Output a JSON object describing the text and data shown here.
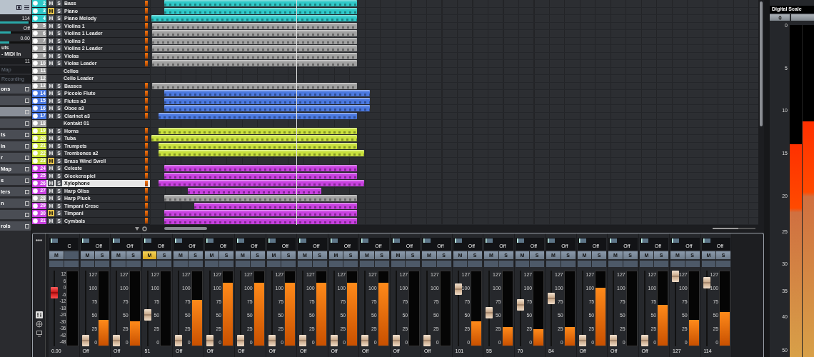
{
  "inspector": {
    "sliders": [
      {
        "value": "114",
        "level": 0.95
      },
      {
        "value": "Off",
        "level": 0.35
      },
      {
        "value": "0.00",
        "level": 0.3
      }
    ],
    "routing": [
      "uts",
      "- MIDI In",
      "11"
    ],
    "options": [
      {
        "label": "Map",
        "disabled": true
      },
      {
        "label": "Recording",
        "disabled": true
      }
    ],
    "sections": [
      {
        "label": "ons",
        "selected": false
      },
      {
        "selected": false
      },
      {
        "selected": true
      },
      {
        "selected": false
      },
      {
        "label": "ts",
        "selected": false
      },
      {
        "label": "in",
        "selected": false
      },
      {
        "label": "r",
        "selected": false
      },
      {
        "label": "Map",
        "selected": false
      },
      {
        "label": "s",
        "selected": false
      },
      {
        "label": "lers",
        "selected": false
      },
      {
        "label": "n",
        "selected": false
      },
      {
        "selected": false
      },
      {
        "label": "rols",
        "selected": false
      }
    ]
  },
  "tracks": [
    {
      "number": "2",
      "name": "Bass",
      "color": "#2ec8c8",
      "kind": "track",
      "m": "M",
      "s": "S",
      "muted": false,
      "selected": false
    },
    {
      "number": "3",
      "name": "Piano",
      "color": "#2ec8c8",
      "kind": "track",
      "m": "M",
      "s": "S",
      "muted": true,
      "selected": false
    },
    {
      "number": "4",
      "name": "Piano Melody",
      "color": "#2ec8c8",
      "kind": "track",
      "m": "M",
      "s": "S",
      "muted": false,
      "selected": false
    },
    {
      "number": "5",
      "name": "Violins 1",
      "color": "#a0a0a0",
      "kind": "track",
      "m": "M",
      "s": "S",
      "muted": false,
      "selected": false
    },
    {
      "number": "6",
      "name": "Violins 1 Leader",
      "color": "#a0a0a0",
      "kind": "track",
      "m": "M",
      "s": "S",
      "muted": false,
      "selected": false
    },
    {
      "number": "7",
      "name": "Violins 2",
      "color": "#a0a0a0",
      "kind": "track",
      "m": "M",
      "s": "S",
      "muted": false,
      "selected": false
    },
    {
      "number": "8",
      "name": "Violins 2 Leader",
      "color": "#a0a0a0",
      "kind": "track",
      "m": "M",
      "s": "S",
      "muted": false,
      "selected": false
    },
    {
      "number": "9",
      "name": "Violas",
      "color": "#a0a0a0",
      "kind": "track",
      "m": "M",
      "s": "S",
      "muted": false,
      "selected": false
    },
    {
      "number": "10",
      "name": "Violas Leader",
      "color": "#a0a0a0",
      "kind": "track",
      "m": "M",
      "s": "S",
      "muted": false,
      "selected": false
    },
    {
      "number": "11",
      "name": "Cellos",
      "color": "#a0a0a0",
      "kind": "bare",
      "selected": false
    },
    {
      "number": "12",
      "name": "Cello Leader",
      "color": "#a0a0a0",
      "kind": "bare",
      "selected": false
    },
    {
      "number": "13",
      "name": "Basses",
      "color": "#a0a0a0",
      "kind": "track",
      "m": "M",
      "s": "S",
      "muted": false,
      "selected": false
    },
    {
      "number": "14",
      "name": "Piccolo Flute",
      "color": "#4a78e0",
      "kind": "track",
      "m": "M",
      "s": "S",
      "muted": false,
      "selected": false
    },
    {
      "number": "15",
      "name": "Flutes a3",
      "color": "#4a78e0",
      "kind": "track",
      "m": "M",
      "s": "S",
      "muted": false,
      "selected": false
    },
    {
      "number": "16",
      "name": "Oboe a3",
      "color": "#4a78e0",
      "kind": "track",
      "m": "M",
      "s": "S",
      "muted": false,
      "selected": false
    },
    {
      "number": "17",
      "name": "Clarinet a3",
      "color": "#4a78e0",
      "kind": "track",
      "m": "M",
      "s": "S",
      "muted": false,
      "selected": false
    },
    {
      "number": "18",
      "name": "Kontakt 01",
      "color": "#a0a0a0",
      "kind": "bare",
      "selected": false
    },
    {
      "number": "19",
      "name": "Horns",
      "color": "#c8e03c",
      "kind": "track",
      "m": "M",
      "s": "S",
      "muted": false,
      "selected": false
    },
    {
      "number": "20",
      "name": "Tuba",
      "color": "#c8e03c",
      "kind": "track",
      "m": "M",
      "s": "S",
      "muted": false,
      "selected": false
    },
    {
      "number": "21",
      "name": "Trumpets",
      "color": "#c8e03c",
      "kind": "track",
      "m": "M",
      "s": "S",
      "muted": false,
      "selected": false
    },
    {
      "number": "22",
      "name": "Trombones a2",
      "color": "#c8e03c",
      "kind": "track",
      "m": "M",
      "s": "S",
      "muted": false,
      "selected": false
    },
    {
      "number": "23",
      "name": "Brass Wind Swell",
      "color": "#c8e03c",
      "kind": "track",
      "m": "M",
      "s": "S",
      "muted": true,
      "selected": false
    },
    {
      "number": "24",
      "name": "Celeste",
      "color": "#c840e0",
      "kind": "track",
      "m": "M",
      "s": "S",
      "muted": false,
      "selected": false
    },
    {
      "number": "25",
      "name": "Glockenspiel",
      "color": "#c840e0",
      "kind": "track",
      "m": "M",
      "s": "S",
      "muted": false,
      "selected": false
    },
    {
      "number": "26",
      "name": "Xylophone",
      "color": "#c840e0",
      "kind": "track",
      "m": "M",
      "s": "S",
      "muted": false,
      "selected": true
    },
    {
      "number": "27",
      "name": "Harp Gliss",
      "color": "#c840e0",
      "kind": "track",
      "m": "M",
      "s": "S",
      "muted": false,
      "selected": false
    },
    {
      "number": "28",
      "name": "Harp Pluck",
      "color": "#a0a0a0",
      "kind": "track",
      "m": "M",
      "s": "S",
      "muted": false,
      "selected": false
    },
    {
      "number": "29",
      "name": "Timpani Cresc",
      "color": "#c840e0",
      "kind": "track",
      "m": "M",
      "s": "S",
      "muted": false,
      "selected": false
    },
    {
      "number": "30",
      "name": "Timpani",
      "color": "#c840e0",
      "kind": "track",
      "m": "M",
      "s": "S",
      "muted": true,
      "selected": false
    },
    {
      "number": "31",
      "name": "Cymbals",
      "color": "#c840e0",
      "kind": "track",
      "m": "M",
      "s": "S",
      "muted": false,
      "selected": false
    }
  ],
  "mixer": {
    "strips": [
      {
        "kind": "master",
        "top": "C",
        "m": "M",
        "muted": false,
        "scale": [
          "12",
          "6",
          "0",
          "-6",
          "-12",
          "-18",
          "-24",
          "-30",
          "-36",
          "-42",
          "-48"
        ],
        "fader": {
          "level": 0.75
        },
        "meter": {
          "level": 0
        },
        "value": "0.00"
      },
      {
        "kind": "midi",
        "top": "Off",
        "m": "M",
        "s": "S",
        "muted": false,
        "scale": [
          "127",
          "100",
          "75",
          "50",
          "25",
          "0"
        ],
        "fader": {
          "level": 0
        },
        "meter": {
          "level": 0.35
        },
        "value": "Off"
      },
      {
        "kind": "midi",
        "top": "Off",
        "m": "M",
        "s": "S",
        "muted": false,
        "scale": [
          "127",
          "100",
          "75",
          "50",
          "25",
          "0"
        ],
        "fader": {
          "level": 0
        },
        "meter": {
          "level": 0.33
        },
        "value": "Off"
      },
      {
        "kind": "midi",
        "top": "Off",
        "m": "M",
        "s": "S",
        "muted": true,
        "scale": [
          "127",
          "100",
          "75",
          "50",
          "25",
          "0"
        ],
        "fader": {
          "level": 0.4
        },
        "meter": {
          "level": 0
        },
        "value": "51"
      },
      {
        "kind": "midi",
        "top": "Off",
        "m": "M",
        "s": "S",
        "muted": false,
        "scale": [
          "127",
          "100",
          "75",
          "50",
          "25",
          "0"
        ],
        "fader": {
          "level": 0
        },
        "meter": {
          "level": 0.62
        },
        "value": "Off"
      },
      {
        "kind": "midi",
        "top": "Off",
        "m": "M",
        "s": "S",
        "muted": false,
        "scale": [
          "127",
          "100",
          "75",
          "50",
          "25",
          "0"
        ],
        "fader": {
          "level": 0
        },
        "meter": {
          "level": 0.85
        },
        "value": "Off"
      },
      {
        "kind": "midi",
        "top": "Off",
        "m": "M",
        "s": "S",
        "muted": false,
        "scale": [
          "127",
          "100",
          "75",
          "50",
          "25",
          "0"
        ],
        "fader": {
          "level": 0
        },
        "meter": {
          "level": 0.85
        },
        "value": "Off"
      },
      {
        "kind": "midi",
        "top": "Off",
        "m": "M",
        "s": "S",
        "muted": false,
        "scale": [
          "127",
          "100",
          "75",
          "50",
          "25",
          "0"
        ],
        "fader": {
          "level": 0
        },
        "meter": {
          "level": 0.85
        },
        "value": "Off"
      },
      {
        "kind": "midi",
        "top": "Off",
        "m": "M",
        "s": "S",
        "muted": false,
        "scale": [
          "127",
          "100",
          "75",
          "50",
          "25",
          "0"
        ],
        "fader": {
          "level": 0
        },
        "meter": {
          "level": 0.85
        },
        "value": "Off"
      },
      {
        "kind": "midi",
        "top": "Off",
        "m": "M",
        "s": "S",
        "muted": false,
        "scale": [
          "127",
          "100",
          "75",
          "50",
          "25",
          "0"
        ],
        "fader": {
          "level": 0
        },
        "meter": {
          "level": 0.85
        },
        "value": "Off"
      },
      {
        "kind": "midi",
        "top": "Off",
        "m": "M",
        "s": "S",
        "muted": false,
        "scale": [
          "127",
          "100",
          "75",
          "50",
          "25",
          "0"
        ],
        "fader": {
          "level": 0
        },
        "meter": {
          "level": 0.85
        },
        "value": "Off"
      },
      {
        "kind": "midi",
        "top": "Off",
        "m": "M",
        "s": "S",
        "muted": false,
        "scale": [
          "127",
          "100",
          "75",
          "50",
          "25",
          "0"
        ],
        "fader": {
          "level": 0
        },
        "meter": {
          "level": 0
        },
        "value": "Off"
      },
      {
        "kind": "midi",
        "top": "Off",
        "m": "M",
        "s": "S",
        "muted": false,
        "scale": [
          "127",
          "100",
          "75",
          "50",
          "25",
          "0"
        ],
        "fader": {
          "level": 0
        },
        "meter": {
          "level": 0
        },
        "value": "Off"
      },
      {
        "kind": "midi",
        "top": "Off",
        "m": "M",
        "s": "S",
        "muted": false,
        "scale": [
          "127",
          "100",
          "75",
          "50",
          "25",
          "0"
        ],
        "fader": {
          "level": 0.8
        },
        "meter": {
          "level": 0.33
        },
        "value": "101"
      },
      {
        "kind": "midi",
        "top": "Off",
        "m": "M",
        "s": "S",
        "muted": false,
        "scale": [
          "127",
          "100",
          "75",
          "50",
          "25",
          "0"
        ],
        "fader": {
          "level": 0.43
        },
        "meter": {
          "level": 0.25
        },
        "value": "55"
      },
      {
        "kind": "midi",
        "top": "Off",
        "m": "M",
        "s": "S",
        "muted": false,
        "scale": [
          "127",
          "100",
          "75",
          "50",
          "25",
          "0"
        ],
        "fader": {
          "level": 0.55
        },
        "meter": {
          "level": 0.22
        },
        "value": "70"
      },
      {
        "kind": "midi",
        "top": "Off",
        "m": "M",
        "s": "S",
        "muted": false,
        "scale": [
          "127",
          "100",
          "75",
          "50",
          "25",
          "0"
        ],
        "fader": {
          "level": 0.66
        },
        "meter": {
          "level": 0.25
        },
        "value": "84"
      },
      {
        "kind": "midi",
        "top": "Off",
        "m": "M",
        "s": "S",
        "muted": false,
        "scale": [
          "127",
          "100",
          "75",
          "50",
          "25",
          "0"
        ],
        "fader": {
          "level": 0
        },
        "meter": {
          "level": 0.78
        },
        "value": "Off"
      },
      {
        "kind": "midi",
        "top": "Off",
        "m": "M",
        "s": "S",
        "muted": false,
        "scale": [
          "127",
          "100",
          "75",
          "50",
          "25",
          "0"
        ],
        "fader": {
          "level": 0
        },
        "meter": {
          "level": 0
        },
        "value": "Off"
      },
      {
        "kind": "midi",
        "top": "Off",
        "m": "M",
        "s": "S",
        "muted": false,
        "scale": [
          "127",
          "100",
          "75",
          "50",
          "25",
          "0"
        ],
        "fader": {
          "level": 0
        },
        "meter": {
          "level": 0.55
        },
        "value": "Off"
      },
      {
        "kind": "midi",
        "top": "Off",
        "m": "M",
        "s": "S",
        "muted": false,
        "scale": [
          "127",
          "100",
          "75",
          "50",
          "25",
          "0"
        ],
        "fader": {
          "level": 1
        },
        "meter": {
          "level": 0.35
        },
        "value": "127"
      },
      {
        "kind": "midi",
        "top": "Off",
        "m": "M",
        "s": "S",
        "muted": false,
        "scale": [
          "127",
          "100",
          "75",
          "50",
          "25",
          "0"
        ],
        "fader": {
          "level": 0.9
        },
        "meter": {
          "level": 0.45
        },
        "value": "114"
      }
    ]
  },
  "arrange": {
    "zoom": {
      "level": 0.6
    }
  },
  "meter_bridge": {
    "title": "Digital Scale",
    "scale": [
      "0",
      "5",
      "10",
      "15",
      "20",
      "25",
      "30",
      "35",
      "40",
      "50"
    ],
    "channels": [
      {
        "level": 0.64
      },
      {
        "level": 0.71
      }
    ]
  }
}
